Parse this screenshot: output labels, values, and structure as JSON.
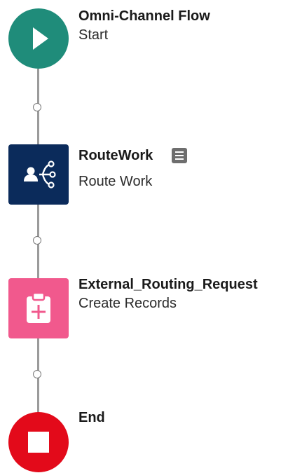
{
  "colors": {
    "start": "#1f8c7a",
    "route_work": "#0b2b5b",
    "create_records": "#f1598d",
    "end": "#e30a1a",
    "connector": "#9b9b9b"
  },
  "nodes": {
    "start": {
      "title": "Omni-Channel Flow",
      "subtitle": "Start",
      "icon": "play-icon"
    },
    "route_work": {
      "title": "RouteWork",
      "subtitle": "Route Work",
      "icon": "route-work-icon",
      "badge_icon": "description-icon"
    },
    "create_records": {
      "title": "External_Routing_Request",
      "subtitle": "Create Records",
      "icon": "create-records-icon"
    },
    "end": {
      "title": "End",
      "icon": "stop-icon"
    }
  }
}
